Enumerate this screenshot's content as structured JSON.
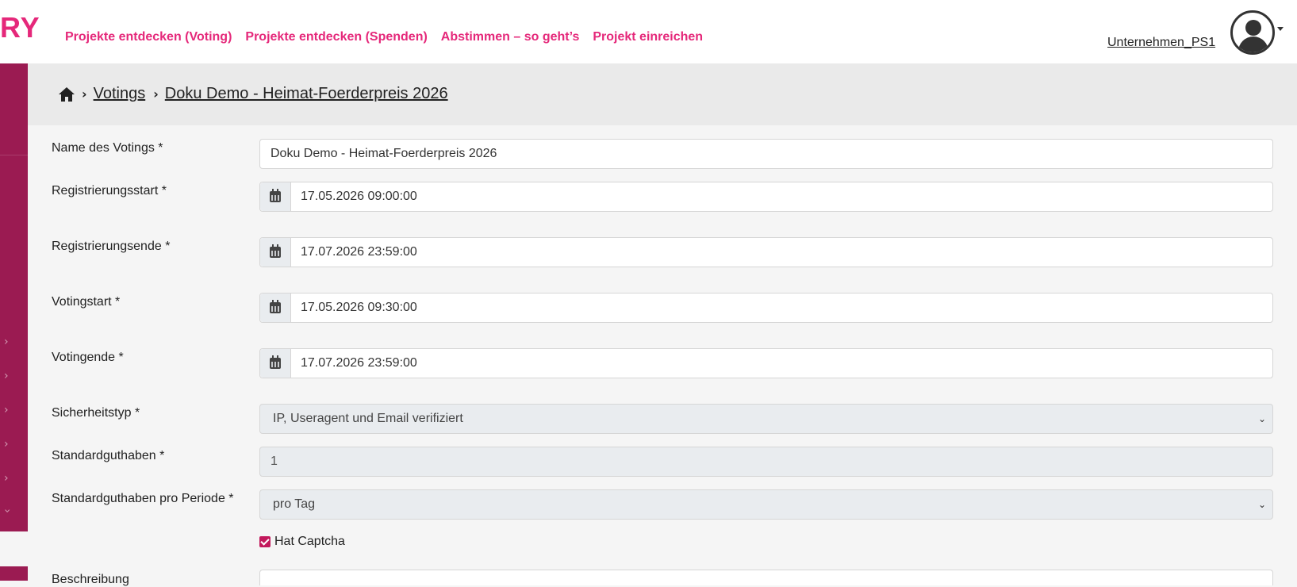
{
  "header": {
    "logo_text": "RY",
    "nav": [
      "Projekte entdecken (Voting)",
      "Projekte entdecken (Spenden)",
      "Abstimmen – so geht’s",
      "Projekt einreichen"
    ],
    "user_name": "Unternehmen_PS1"
  },
  "breadcrumb": {
    "level1": "Votings",
    "level2": "Doku Demo - Heimat-Foerderpreis 2026"
  },
  "form": {
    "name_label": "Name des Votings *",
    "name_value": "Doku Demo - Heimat-Foerderpreis 2026",
    "reg_start_label": "Registrierungsstart *",
    "reg_start_value": "17.05.2026 09:00:00",
    "reg_end_label": "Registrierungsende *",
    "reg_end_value": "17.07.2026 23:59:00",
    "vote_start_label": "Votingstart *",
    "vote_start_value": "17.05.2026 09:30:00",
    "vote_end_label": "Votingende *",
    "vote_end_value": "17.07.2026 23:59:00",
    "security_label": "Sicherheitstyp *",
    "security_value": "IP, Useragent und Email verifiziert",
    "credit_label": "Standardguthaben *",
    "credit_value": "1",
    "credit_period_label": "Standardguthaben pro Periode *",
    "credit_period_value": "pro Tag",
    "captcha_label": "Hat Captcha",
    "captcha_checked": true,
    "description_label": "Beschreibung"
  },
  "colors": {
    "brand_pink": "#e5287a",
    "sidebar": "#9b1b52"
  }
}
